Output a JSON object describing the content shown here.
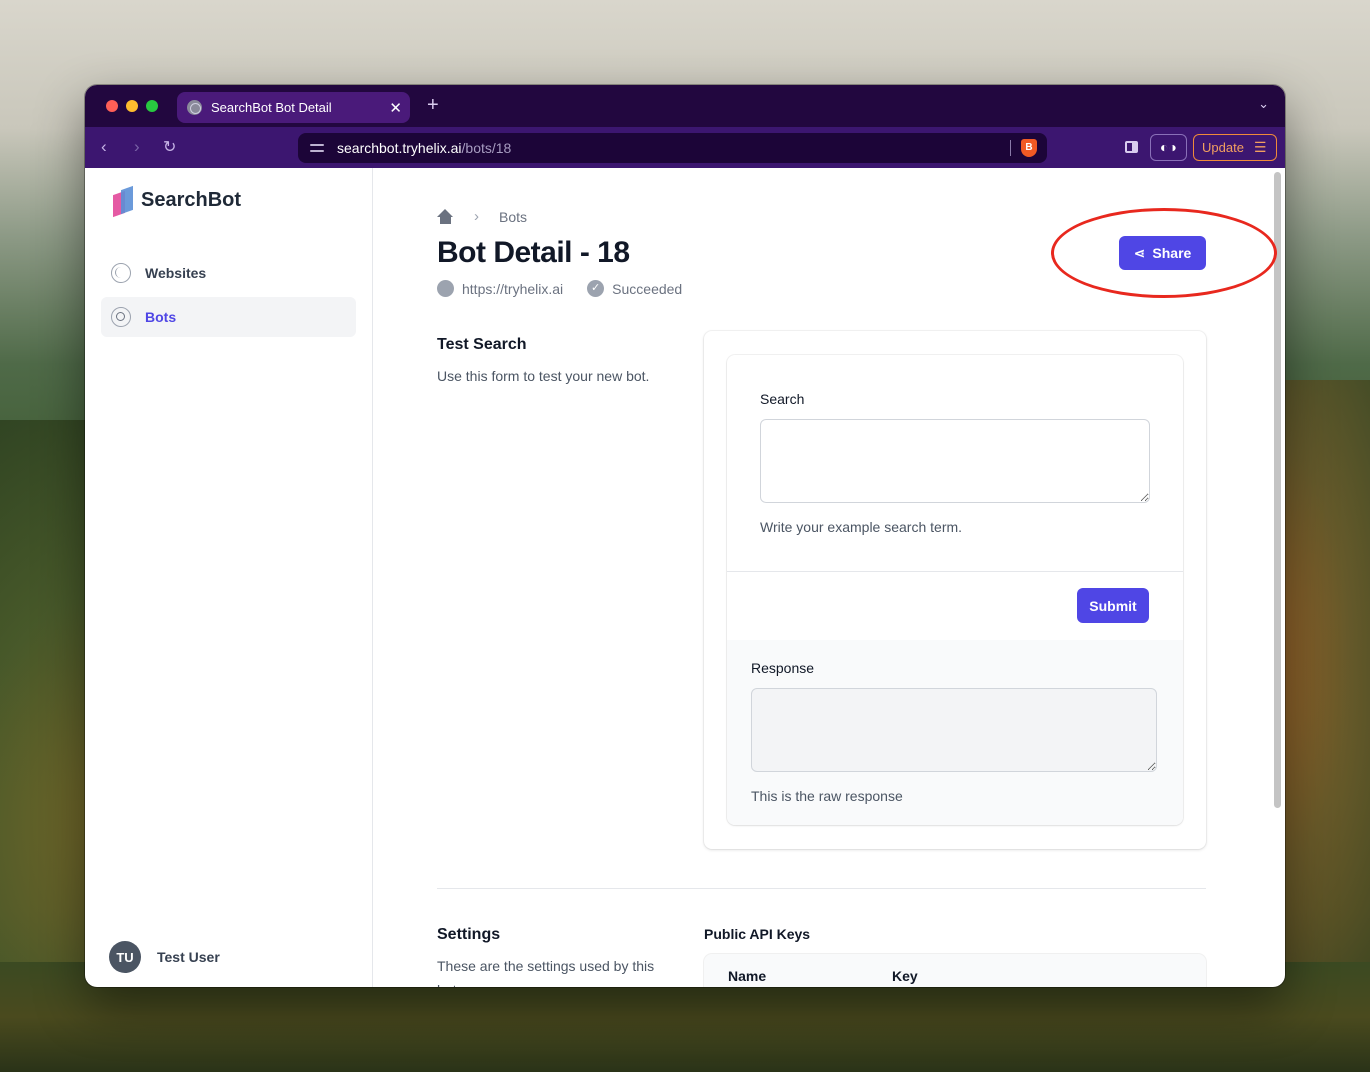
{
  "browser": {
    "tab_title": "SearchBot Bot Detail",
    "tab_close": "✕",
    "new_tab": "+",
    "tab_menu": "⌄",
    "url_host": "searchbot.tryhelix.ai",
    "url_path": "/bots/18",
    "update_label": "Update",
    "brave_glyph": "B",
    "glasses_glyph": "◐◑"
  },
  "sidebar": {
    "logo_text": "SearchBot",
    "items": [
      {
        "label": "Websites",
        "icon": "globe-icon",
        "active": false
      },
      {
        "label": "Bots",
        "icon": "search-icon",
        "active": true
      }
    ],
    "user": {
      "initials": "TU",
      "name": "Test User"
    }
  },
  "main": {
    "breadcrumb": {
      "separator": "›",
      "current": "Bots"
    },
    "title": "Bot Detail - 18",
    "meta": {
      "url": "https://tryhelix.ai",
      "status": "Succeeded",
      "status_glyph": "✓"
    },
    "share_label": "Share",
    "test_search": {
      "title": "Test Search",
      "description": "Use this form to test your new bot.",
      "search_label": "Search",
      "search_value": "",
      "search_hint": "Write your example search term.",
      "submit_label": "Submit",
      "response_label": "Response",
      "response_value": "",
      "response_hint": "This is the raw response"
    },
    "settings": {
      "title": "Settings",
      "description": "These are the settings used by this bot.",
      "api_keys_label": "Public API Keys",
      "columns": [
        "Name",
        "Key"
      ]
    }
  },
  "colors": {
    "accent": "#4f46e5",
    "annotation": "#e8281e",
    "titlebar": "#22073f",
    "toolbar": "#3c1670"
  }
}
